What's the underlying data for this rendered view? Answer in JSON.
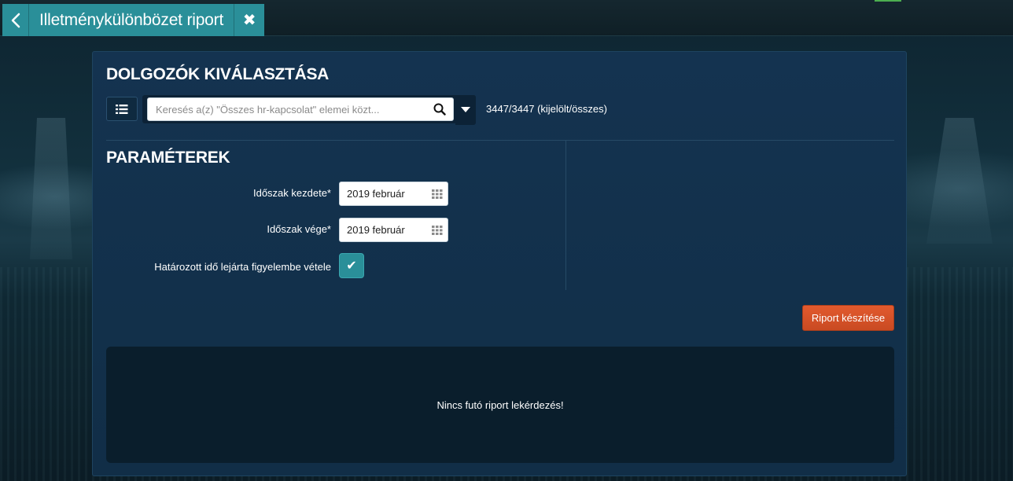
{
  "tab": {
    "title": "Illetménykülönbözet riport"
  },
  "employees": {
    "heading": "DOLGOZÓK KIVÁLASZTÁSA",
    "search_placeholder": "Keresés a(z) \"Összes hr-kapcsolat\" elemei közt...",
    "count_text": "3447/3447 (kijelölt/összes)"
  },
  "parameters": {
    "heading": "PARAMÉTEREK",
    "start_label": "Időszak kezdete*",
    "start_value": "2019 február",
    "end_label": "Időszak vége*",
    "end_value": "2019 február",
    "fixed_term_label": "Határozott idő lejárta figyelembe vétele",
    "fixed_term_checked": true
  },
  "actions": {
    "report_button": "Riport készítése"
  },
  "result": {
    "status_text": "Nincs futó riport lekérdezés!"
  },
  "colors": {
    "accent_teal": "#2a8f99",
    "action_orange": "#d9532a",
    "panel_bg": "#12304a"
  }
}
